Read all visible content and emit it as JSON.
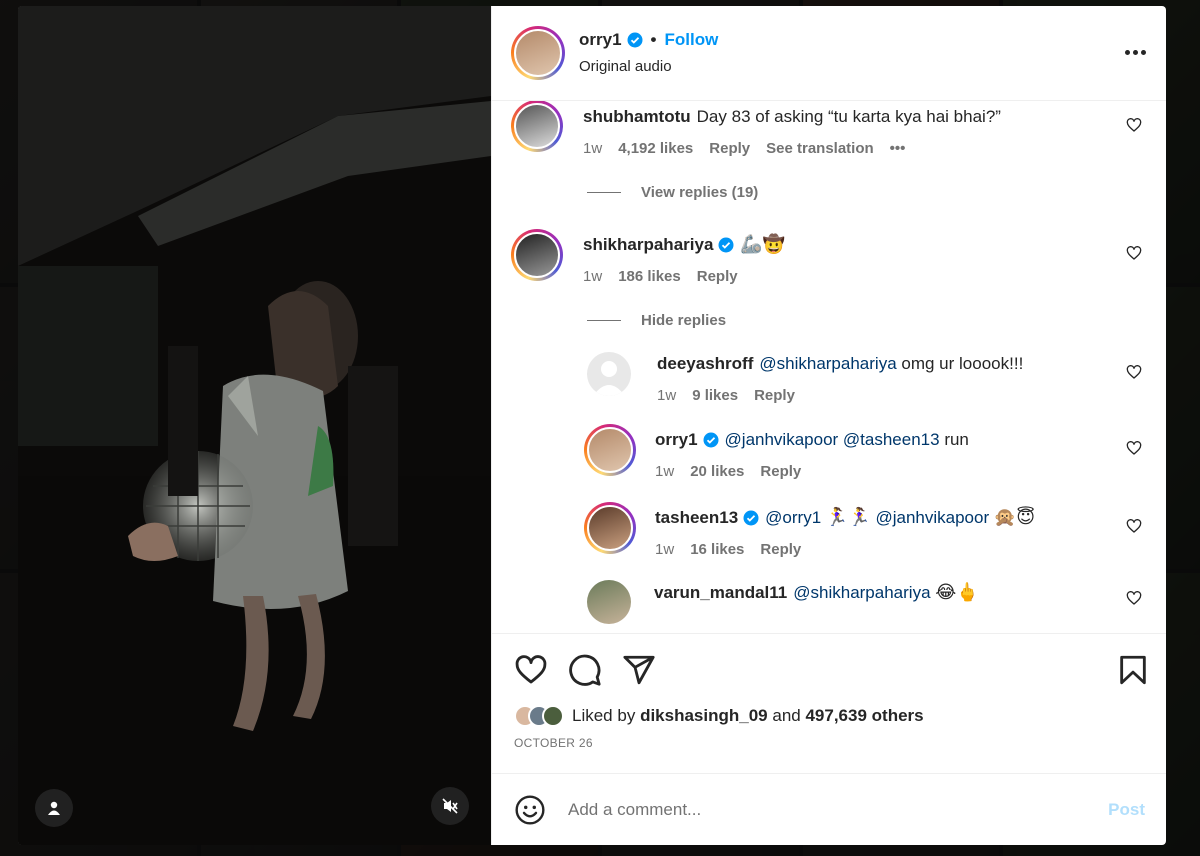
{
  "post": {
    "author": "orry1",
    "separator": "•",
    "follow_label": "Follow",
    "audio": "Original audio"
  },
  "comments": [
    {
      "user": "shubhamtotu",
      "text": "Day 83 of asking “tu karta kya hai bhai?”",
      "time": "1w",
      "likes": "4,192 likes",
      "reply_label": "Reply",
      "translate_label": "See translation",
      "more_label": "•••",
      "replies_toggle": "View replies (19)"
    },
    {
      "user": "shikharpahariya",
      "verified": true,
      "text": "🦾🤠",
      "time": "1w",
      "likes": "186 likes",
      "reply_label": "Reply",
      "replies_toggle": "Hide replies",
      "replies": [
        {
          "user": "deeyashroff",
          "mention": "@shikharpahariya",
          "text": "omg ur looook!!!",
          "time": "1w",
          "likes": "9 likes",
          "reply_label": "Reply"
        },
        {
          "user": "orry1",
          "verified": true,
          "mention": "@janhvikapoor @tasheen13",
          "text": "run",
          "time": "1w",
          "likes": "20 likes",
          "reply_label": "Reply"
        },
        {
          "user": "tasheen13",
          "verified": true,
          "mention": "@orry1",
          "emoji_mid": "🏃‍♀️🏃‍♀️",
          "mention2": "@janhvikapoor",
          "text": "🙊😇",
          "time": "1w",
          "likes": "16 likes",
          "reply_label": "Reply"
        },
        {
          "user": "varun_mandal11",
          "mention": "@shikharpahariya",
          "text": "😂🖕"
        }
      ]
    }
  ],
  "actions": {
    "liked_prefix": "Liked by",
    "liked_user": "dikshasingh_09",
    "liked_and": "and",
    "liked_others": "497,639 others",
    "date": "OCTOBER 26"
  },
  "composer": {
    "placeholder": "Add a comment...",
    "post_label": "Post"
  },
  "colors": {
    "accent": "#0095f6",
    "verified": "#0095f6",
    "mention": "#00376b",
    "post_disabled": "#b2dffc"
  }
}
